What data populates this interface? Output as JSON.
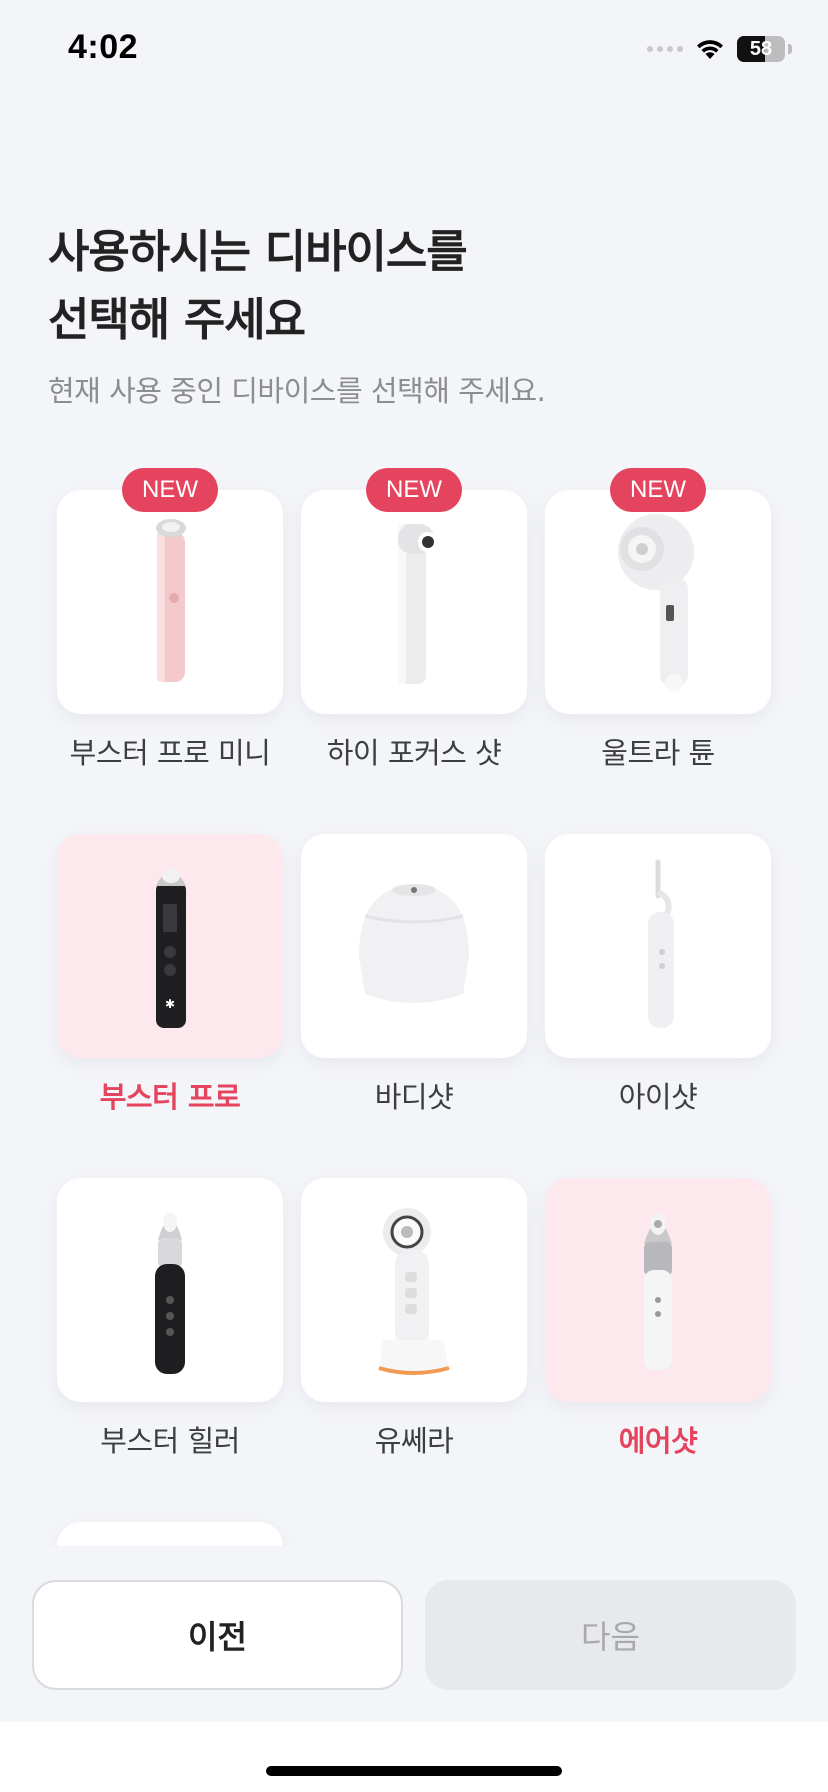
{
  "status": {
    "time": "4:02",
    "battery": "58",
    "battery_level": 0.58
  },
  "heading": {
    "title_line1": "사용하시는 디바이스를",
    "title_line2": "선택해 주세요",
    "subtitle": "현재 사용 중인 디바이스를 선택해 주세요."
  },
  "devices": [
    {
      "label": "부스터 프로 미니",
      "badge": "NEW",
      "selected": false,
      "icon": "pink-stick-device-icon"
    },
    {
      "label": "하이 포커스 샷",
      "badge": "NEW",
      "selected": false,
      "icon": "white-l-shaped-device-icon"
    },
    {
      "label": "울트라 튠",
      "badge": "NEW",
      "selected": false,
      "icon": "white-round-head-device-icon"
    },
    {
      "label": "부스터 프로",
      "badge": "",
      "selected": true,
      "icon": "black-stick-device-icon"
    },
    {
      "label": "바디샷",
      "badge": "",
      "selected": false,
      "icon": "white-dome-device-icon"
    },
    {
      "label": "아이샷",
      "badge": "",
      "selected": false,
      "icon": "white-slim-wand-icon"
    },
    {
      "label": "부스터 힐러",
      "badge": "",
      "selected": false,
      "icon": "black-wand-device-icon"
    },
    {
      "label": "유쎄라",
      "badge": "",
      "selected": false,
      "icon": "white-orange-dock-device-icon"
    },
    {
      "label": "에어샷",
      "badge": "",
      "selected": true,
      "icon": "white-grey-stick-device-icon"
    },
    {
      "label": "",
      "badge": "",
      "selected": false,
      "icon": ""
    }
  ],
  "buttons": {
    "prev": "이전",
    "next": "다음"
  },
  "colors": {
    "accent": "#e5445f",
    "selected_tile": "#fde8ee",
    "background": "#f4f5f9"
  }
}
